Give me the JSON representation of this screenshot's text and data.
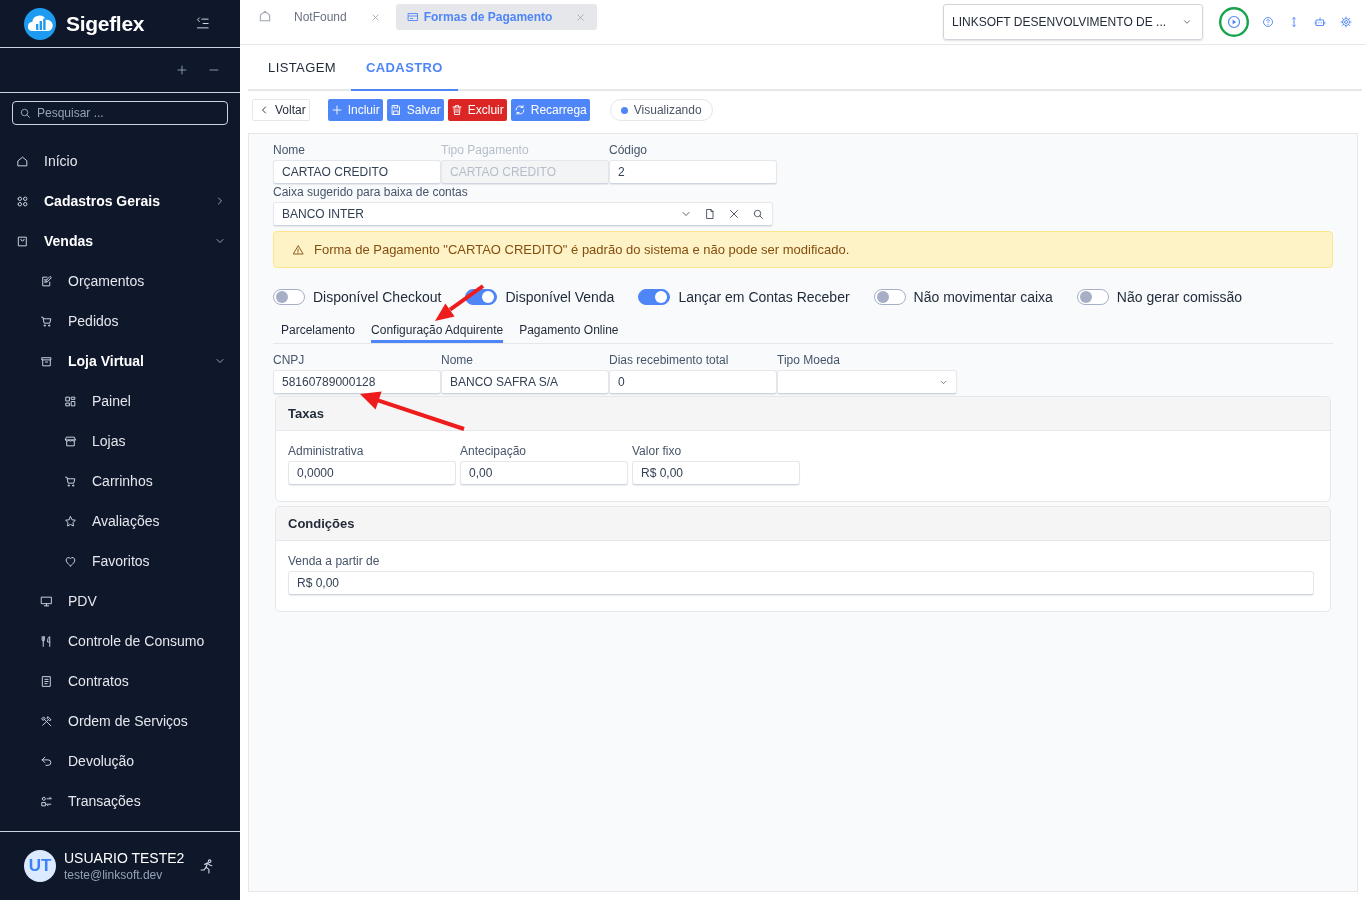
{
  "sidebar": {
    "brand": "Sigeflex",
    "search": {
      "placeholder": "Pesquisar ..."
    },
    "items": [
      {
        "label": "Início"
      },
      {
        "label": "Cadastros Gerais",
        "expanded": false
      },
      {
        "label": "Vendas",
        "expanded": true,
        "children": [
          {
            "label": "Orçamentos"
          },
          {
            "label": "Pedidos"
          },
          {
            "label": "Loja Virtual",
            "expanded": true,
            "children": [
              {
                "label": "Painel"
              },
              {
                "label": "Lojas"
              },
              {
                "label": "Carrinhos"
              },
              {
                "label": "Avaliações"
              },
              {
                "label": "Favoritos"
              }
            ]
          },
          {
            "label": "PDV"
          },
          {
            "label": "Controle de Consumo"
          },
          {
            "label": "Contratos"
          },
          {
            "label": "Ordem de Serviços"
          },
          {
            "label": "Devolução"
          },
          {
            "label": "Transações"
          }
        ]
      }
    ],
    "user": {
      "initials": "UT",
      "name": "USUARIO TESTE2",
      "email": "teste@linksoft.dev"
    }
  },
  "top_bar": {
    "tabs": [
      {
        "label": "NotFound",
        "selected": false
      },
      {
        "label": "Formas de Pagamento",
        "selected": true
      }
    ],
    "company_select": {
      "value": "LINKSOFT DESENVOLVIMENTO DE ..."
    }
  },
  "page_tabs": [
    {
      "label": "LISTAGEM",
      "selected": false
    },
    {
      "label": "CADASTRO",
      "selected": true
    }
  ],
  "toolbar": {
    "buttons": [
      {
        "label": "Voltar",
        "kind": "back"
      },
      {
        "label": "Incluir",
        "kind": "primary"
      },
      {
        "label": "Salvar",
        "kind": "primary"
      },
      {
        "label": "Excluir",
        "kind": "danger"
      },
      {
        "label": "Recarrega",
        "kind": "primary"
      }
    ],
    "status": "Visualizando"
  },
  "form": {
    "fields": [
      {
        "label": "Nome",
        "value": "CARTAO CREDITO",
        "disabled": false
      },
      {
        "label": "Tipo Pagamento",
        "value": "CARTAO CREDITO",
        "disabled": true
      },
      {
        "label": "Código",
        "value": "2",
        "disabled": false
      }
    ],
    "cash_register": {
      "label": "Caixa sugerido para baixa de contas",
      "value": "BANCO INTER"
    },
    "alert": "Forma de Pagamento \"CARTAO CREDITO\" é padrão do sistema e não pode ser modificado.",
    "toggles": [
      {
        "label": "Disponível Checkout",
        "on": false
      },
      {
        "label": "Disponível Venda",
        "on": true
      },
      {
        "label": "Lançar em Contas Receber",
        "on": true
      },
      {
        "label": "Não movimentar caixa",
        "on": false
      },
      {
        "label": "Não gerar comissão",
        "on": false
      }
    ],
    "subtabs": [
      {
        "label": "Parcelamento",
        "selected": false,
        "marked_by_arrow": false
      },
      {
        "label": "Configuração Adquirente",
        "selected": true,
        "marked_by_arrow": true
      },
      {
        "label": "Pagamento Online",
        "selected": false,
        "marked_by_arrow": false
      }
    ],
    "acquirer_fields": [
      {
        "label": "CNPJ",
        "value": "58160789000128",
        "kind": "text",
        "marked_by_arrow": true
      },
      {
        "label": "Nome",
        "value": "BANCO SAFRA S/A",
        "kind": "text",
        "marked_by_arrow": false
      },
      {
        "label": "Dias recebimento total",
        "value": "0",
        "kind": "text",
        "marked_by_arrow": false
      },
      {
        "label": "Tipo Moeda",
        "kind": "select",
        "marked_by_arrow": false
      }
    ],
    "sections": [
      {
        "title": "Taxas",
        "fields": [
          {
            "label": "Administrativa",
            "value": "0,0000"
          },
          {
            "label": "Antecipação",
            "value": "0,00"
          },
          {
            "label": "Valor fixo",
            "value": "R$ 0,00"
          }
        ]
      },
      {
        "title": "Condições",
        "fields": [
          {
            "label": "Venda a partir de",
            "value": "R$ 0,00"
          }
        ]
      }
    ]
  }
}
